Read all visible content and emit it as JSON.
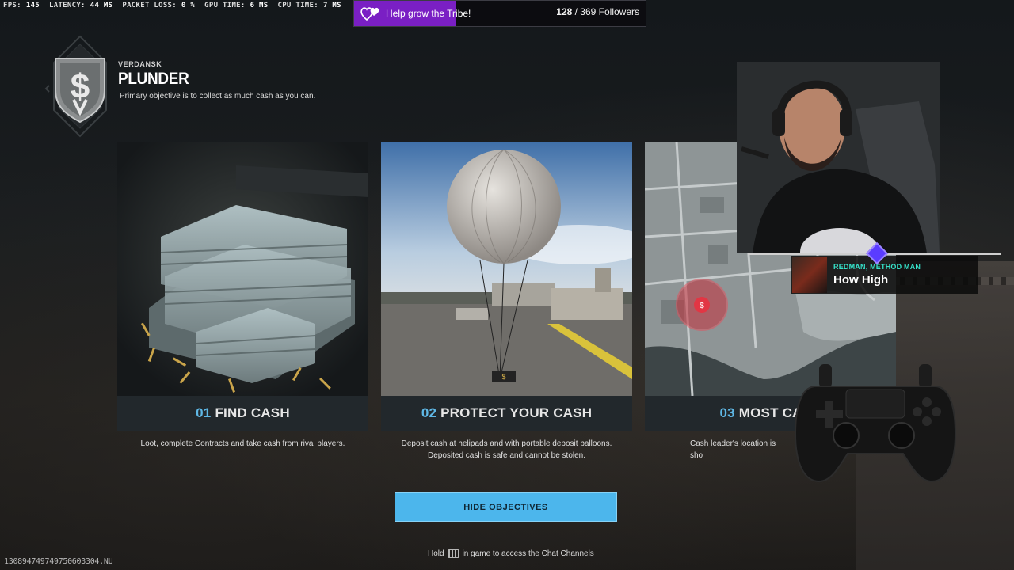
{
  "stats": {
    "fps_label": "FPS:",
    "fps": "145",
    "latency_label": "LATENCY:",
    "latency": "44 MS",
    "packet_loss_label": "PACKET LOSS:",
    "packet_loss": "0 %",
    "gpu_time_label": "GPU TIME:",
    "gpu_time": "6 MS",
    "cpu_time_label": "CPU TIME:",
    "cpu_time": "7 MS"
  },
  "follower_goal": {
    "message": "Help grow the Tribe!",
    "current": "128",
    "goal_text": " / 369 Followers",
    "progress": 0.35,
    "color": "#7a1fc4",
    "icon": "hearts-icon"
  },
  "header": {
    "map": "VERDANSK",
    "mode": "PLUNDER",
    "description": "Primary objective is to collect as much cash as you can.",
    "emblem_icon": "dollar-shield-icon"
  },
  "objectives": [
    {
      "num": "01",
      "title": "FIND CASH",
      "desc_lines": [
        "Loot, complete Contracts and take cash from rival players."
      ],
      "image": "cash-stacks-image"
    },
    {
      "num": "02",
      "title": "PROTECT YOUR CASH",
      "desc_lines": [
        "Deposit cash at helipads and with portable deposit balloons.",
        "Deposited cash is safe and cannot be stolen."
      ],
      "image": "deposit-balloon-image"
    },
    {
      "num": "03",
      "title": "MOST CASH",
      "desc_lines": [
        "Cash leader's location is sho"
      ],
      "image": "tactical-map-image"
    }
  ],
  "now_playing": {
    "artist": "REDMAN, METHOD MAN",
    "song": "How High"
  },
  "buttons": {
    "hide_objectives": "HIDE OBJECTIVES"
  },
  "hint": {
    "before": "Hold",
    "after": "in game to access the Chat Channels",
    "key_icon": "keyboard-icon"
  },
  "build_id": "130894749749750603304.NU",
  "colors": {
    "accent_blue": "#4cb6ec",
    "number_blue": "#5fb8e6",
    "artist_teal": "#35e0c8"
  }
}
